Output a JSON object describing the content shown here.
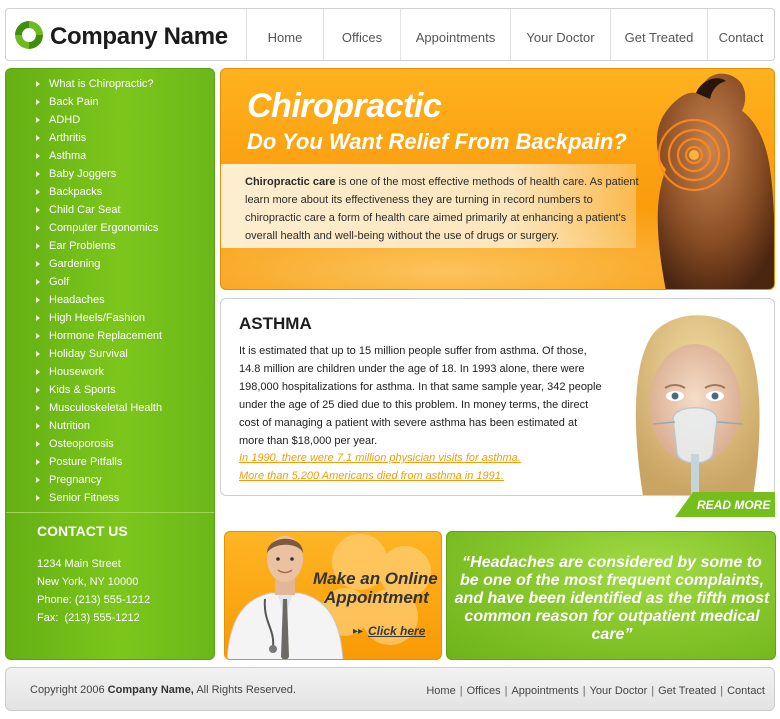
{
  "header": {
    "logo_icon": "company-swirl-logo",
    "company_name": "Company Name",
    "nav": [
      "Home",
      "Offices",
      "Appointments",
      "Your Doctor",
      "Get Treated",
      "Contact"
    ]
  },
  "sidebar": {
    "items": [
      "What is Chiropractic?",
      "Back Pain",
      "ADHD",
      "Arthritis",
      "Asthma",
      "Baby Joggers",
      "Backpacks",
      "Child Car Seat",
      "Computer Ergonomics",
      "Ear Problems",
      "Gardening",
      "Golf",
      "Headaches",
      "High Heels/Fashion",
      "Hormone Replacement",
      "Holiday Survival",
      "Housework",
      "Kids & Sports",
      "Musculoskeletal Health",
      "Nutrition",
      "Osteoporosis",
      "Posture Pitfalls",
      "Pregnancy",
      "Senior Fitness"
    ],
    "contact": {
      "title": "CONTACT US",
      "address1": "1234 Main Street",
      "address2": "New York, NY 10000",
      "phone": "Phone: (213) 555-1212",
      "fax": "Fax:  (213) 555-1212"
    }
  },
  "hero": {
    "title": "Chiropractic",
    "subtitle": "Do You Want Relief From Backpain?",
    "text_bold": "Chiropractic care",
    "text_rest": " is one of the most effective methods of health care. As patient learn more about its effectiveness they are turning in record numbers to chiropractic care a form of health care aimed primarily at enhancing a patient's overall health and well-being without the use of drugs or surgery."
  },
  "asthma": {
    "title": "ASTHMA",
    "body": "It is estimated that up to 15 million people suffer from asthma. Of those, 14.8 million are children under the age of 18. In 1993 alone, there were 198,000 hospitalizations for asthma. In that same sample year, 342 people under the age of 25 died due to this problem. In money terms, the direct cost of managing a patient with severe asthma has been estimated at more than $18,000 per year.",
    "link1": "In 1990, there were 7.1 million physician visits for asthma.",
    "link2": "More than 5,200 Americans died from asthma in 1991.",
    "read_more": "READ MORE"
  },
  "appointment": {
    "line1": "Make an Online",
    "line2": "Appointment",
    "arrow": "▸▸",
    "click": "Click here"
  },
  "quote": {
    "text": "“Headaches are considered by some to be one of the most frequent complaints, and have been identified as the fifth most common reason for outpatient medical care”"
  },
  "footer": {
    "copyright_pre": "Copyright 2006 ",
    "copyright_company": "Company Name,",
    "copyright_post": " All Rights Reserved.",
    "links": [
      "Home",
      "Offices",
      "Appointments",
      "Your Doctor",
      "Get Treated",
      "Contact"
    ],
    "separator": "|"
  },
  "colors": {
    "green": "#74bf1b",
    "orange": "#f9a20e",
    "link_orange": "#f39c0a"
  }
}
